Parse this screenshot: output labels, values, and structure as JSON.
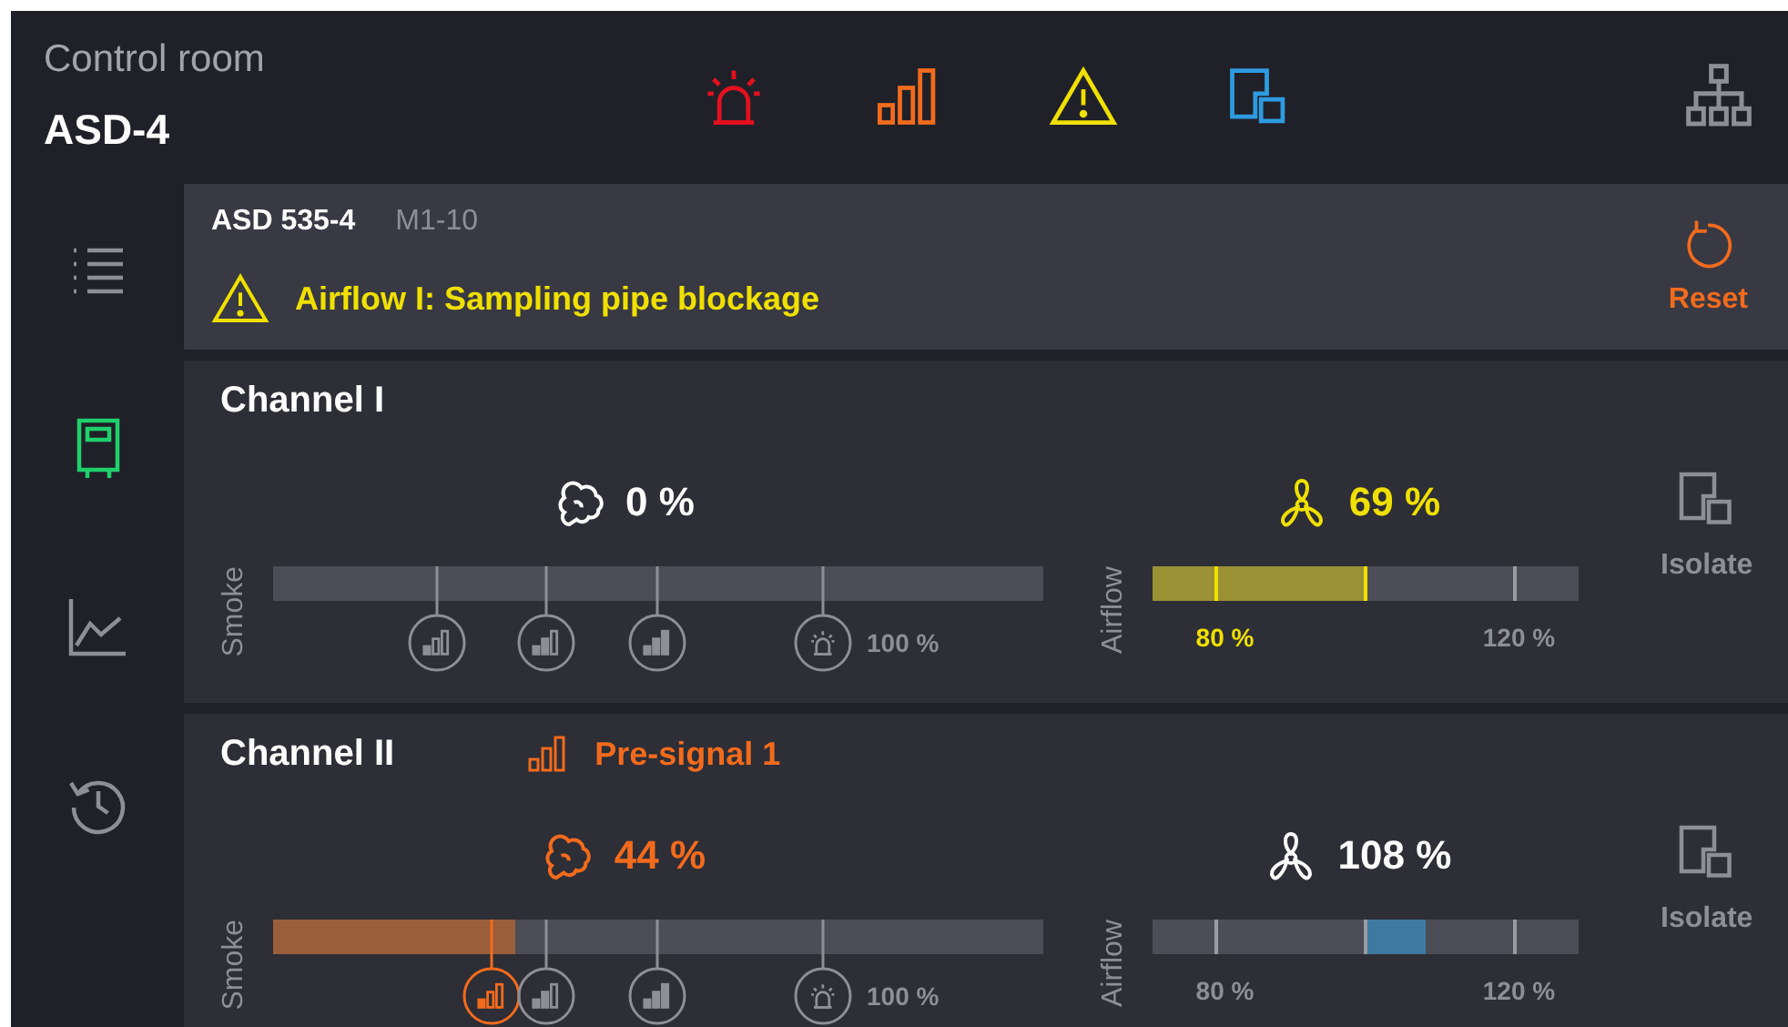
{
  "header": {
    "title": "Control room",
    "device": "ASD-4"
  },
  "sidebar": {
    "items": [
      {
        "kind": "list",
        "selected": false
      },
      {
        "kind": "device",
        "selected": true
      },
      {
        "kind": "trend",
        "selected": false
      },
      {
        "kind": "history",
        "selected": false
      }
    ]
  },
  "alarm": {
    "device": "ASD 535-4",
    "address": "M1-10",
    "kind": "fault",
    "message": "Airflow I: Sampling pipe blockage",
    "action": "Reset"
  },
  "channels": [
    {
      "name": "Channel I",
      "smoke": {
        "label": "Smoke",
        "reading": "0 %",
        "kind": "normal",
        "level": 0,
        "markers": [
          {
            "kind": "pre1",
            "level": 0.213,
            "active": false
          },
          {
            "kind": "pre2",
            "level": 0.355,
            "active": false
          },
          {
            "kind": "pre3",
            "level": 0.499,
            "active": false
          },
          {
            "kind": "alarm",
            "level": 0.714,
            "active": false,
            "label": "100 %"
          }
        ]
      },
      "airflow": {
        "label": "Airflow",
        "reading": "69 %",
        "kind": "fault",
        "level": 0.5,
        "low_label": "80 %",
        "high_label": "120 %"
      },
      "isolate": "Isolate"
    },
    {
      "name": "Channel II",
      "status": {
        "kind": "presignal",
        "text": "Pre-signal 1"
      },
      "smoke": {
        "label": "Smoke",
        "reading": "44 %",
        "kind": "presignal",
        "level": 0.314,
        "markers": [
          {
            "kind": "pre1",
            "level": 0.284,
            "active": true
          },
          {
            "kind": "pre2",
            "level": 0.355,
            "active": false
          },
          {
            "kind": "pre3",
            "level": 0.499,
            "active": false
          },
          {
            "kind": "alarm",
            "level": 0.714,
            "active": false,
            "label": "100 %"
          }
        ]
      },
      "airflow": {
        "label": "Airflow",
        "reading": "108 %",
        "kind": "normal",
        "level": 0.64,
        "low_label": "80 %",
        "high_label": "120 %"
      },
      "isolate": "Isolate"
    }
  ]
}
